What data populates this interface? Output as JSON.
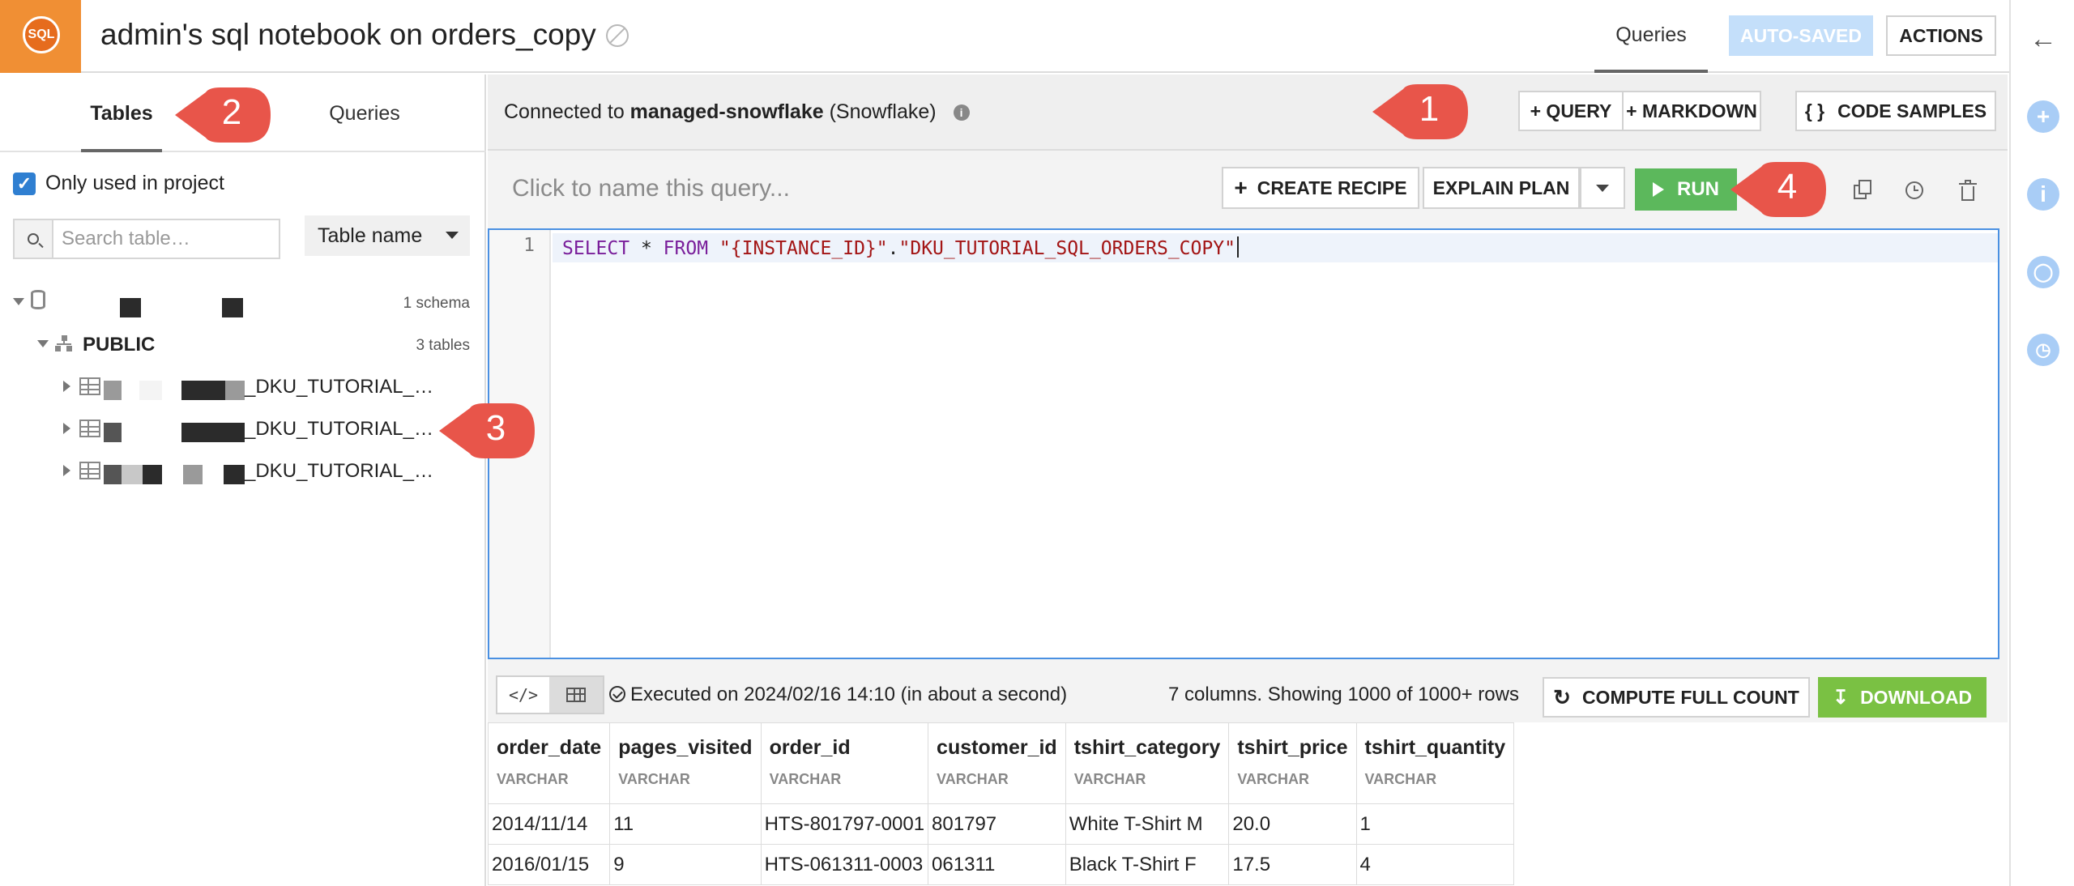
{
  "header": {
    "logo_text": "SQL",
    "notebook_title": "admin's sql notebook on orders_copy",
    "queries_tab": "Queries",
    "autosaved_label": "AUTO-SAVED",
    "actions_label": "ACTIONS"
  },
  "left_panel": {
    "tabs": [
      "Tables",
      "Queries"
    ],
    "only_used_label": "Only used in project",
    "search_placeholder": "Search table…",
    "sort_select": "Table name",
    "tree": {
      "db_count": "1 schema",
      "schema_name": "PUBLIC",
      "schema_count": "3 tables",
      "tables": [
        "_DKU_TUTORIAL_…",
        "_DKU_TUTORIAL_…",
        "_DKU_TUTORIAL_…"
      ]
    }
  },
  "main": {
    "connection_prefix": "Connected to",
    "connection_name": "managed-snowflake",
    "connection_type": "(Snowflake)",
    "add_query_label": "+ QUERY",
    "add_markdown_label": "+ MARKDOWN",
    "code_samples_label": "CODE SAMPLES",
    "query_name_placeholder": "Click to name this query...",
    "create_recipe_label": "CREATE RECIPE",
    "explain_plan_label": "EXPLAIN PLAN",
    "run_label": "RUN",
    "editor": {
      "line_number": "1",
      "kw_select": "SELECT",
      "star": "*",
      "kw_from": "FROM",
      "str_instance": "\"{INSTANCE_ID}\"",
      "dot": ".",
      "str_table": "\"DKU_TUTORIAL_SQL_ORDERS_COPY\""
    }
  },
  "results": {
    "code_toggle": "</>",
    "executed_text": "Executed on 2024/02/16 14:10 (in about a second)",
    "rows_text": "7 columns. Showing 1000 of 1000+ rows",
    "compute_label": "COMPUTE FULL COUNT",
    "download_label": "DOWNLOAD",
    "columns": [
      {
        "name": "order_date",
        "type": "VARCHAR"
      },
      {
        "name": "pages_visited",
        "type": "VARCHAR"
      },
      {
        "name": "order_id",
        "type": "VARCHAR"
      },
      {
        "name": "customer_id",
        "type": "VARCHAR"
      },
      {
        "name": "tshirt_category",
        "type": "VARCHAR"
      },
      {
        "name": "tshirt_price",
        "type": "VARCHAR"
      },
      {
        "name": "tshirt_quantity",
        "type": "VARCHAR"
      }
    ],
    "rows": [
      [
        "2014/11/14",
        "11",
        "HTS-801797-0001",
        "801797",
        "White T-Shirt M",
        "20.0",
        "1"
      ],
      [
        "2016/01/15",
        "9",
        "HTS-061311-0003",
        "061311",
        "Black T-Shirt F",
        "17.5",
        "4"
      ]
    ]
  },
  "callouts": [
    "1",
    "2",
    "3",
    "4"
  ],
  "colors": {
    "brand_orange": "#f08f34",
    "run_green": "#5cb85c",
    "download_green": "#7ac143",
    "callout_red": "#e8554a",
    "autosaved_blue": "#c4dffa",
    "editor_border": "#4a90e2"
  }
}
